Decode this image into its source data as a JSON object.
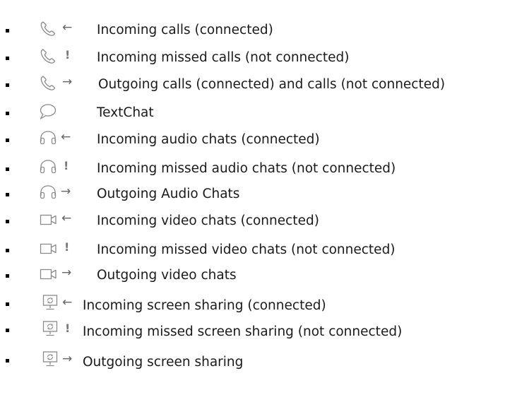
{
  "legend": {
    "items": [
      {
        "icon": "phone-icon",
        "direction": "←",
        "direction_icon": "arrow-left-icon",
        "label": "Incoming calls (connected)"
      },
      {
        "icon": "phone-icon",
        "direction": "!",
        "direction_icon": "exclamation-icon",
        "label": "Incoming missed calls (not connected)"
      },
      {
        "icon": "phone-icon",
        "direction": "→",
        "direction_icon": "arrow-right-icon",
        "label": "Outgoing calls (connected) and calls (not connected)"
      },
      {
        "icon": "chat-bubble-icon",
        "direction": "",
        "direction_icon": "",
        "label": "TextChat"
      },
      {
        "icon": "headphones-icon",
        "direction": "←",
        "direction_icon": "arrow-left-icon",
        "label": "Incoming audio chats (connected)"
      },
      {
        "icon": "headphones-icon",
        "direction": "!",
        "direction_icon": "exclamation-icon",
        "label": "Incoming missed audio chats (not connected)"
      },
      {
        "icon": "headphones-icon",
        "direction": "→",
        "direction_icon": "arrow-right-icon",
        "label": "Outgoing Audio Chats"
      },
      {
        "icon": "video-camera-icon",
        "direction": "←",
        "direction_icon": "arrow-left-icon",
        "label": "Incoming video chats (connected)"
      },
      {
        "icon": "video-camera-icon",
        "direction": "!",
        "direction_icon": "exclamation-icon",
        "label": "Incoming missed video chats (not connected)"
      },
      {
        "icon": "video-camera-icon",
        "direction": "→",
        "direction_icon": "arrow-right-icon",
        "label": "Outgoing video chats"
      },
      {
        "icon": "screen-share-icon",
        "direction": "←",
        "direction_icon": "arrow-left-icon",
        "label": "Incoming screen sharing (connected)"
      },
      {
        "icon": "screen-share-icon",
        "direction": "!",
        "direction_icon": "exclamation-icon",
        "label": "Incoming missed screen sharing (not connected)"
      },
      {
        "icon": "screen-share-icon",
        "direction": "→",
        "direction_icon": "arrow-right-icon",
        "label": "Outgoing screen sharing"
      }
    ]
  },
  "colors": {
    "icon_stroke": "#8a8a8a",
    "text": "#1a1a1a",
    "bullet": "#000000"
  }
}
